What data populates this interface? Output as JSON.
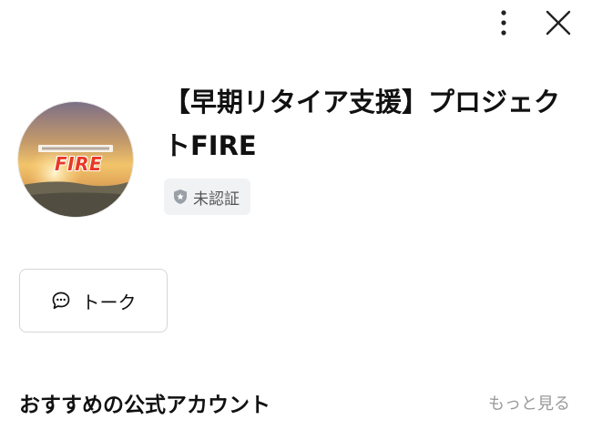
{
  "header": {
    "more_icon": "more-vertical-icon",
    "close_icon": "close-icon"
  },
  "profile": {
    "name": "【早期リタイア支援】プロジェクトFIRE",
    "badge_label": "未認証",
    "badge_icon": "shield-star-icon",
    "logo_text": "FIRE",
    "logo_color": "#e83828"
  },
  "actions": {
    "talk_label": "トーク",
    "talk_icon": "chat-bubble-icon"
  },
  "recommended": {
    "title": "おすすめの公式アカウント",
    "see_more_label": "もっと見る"
  }
}
